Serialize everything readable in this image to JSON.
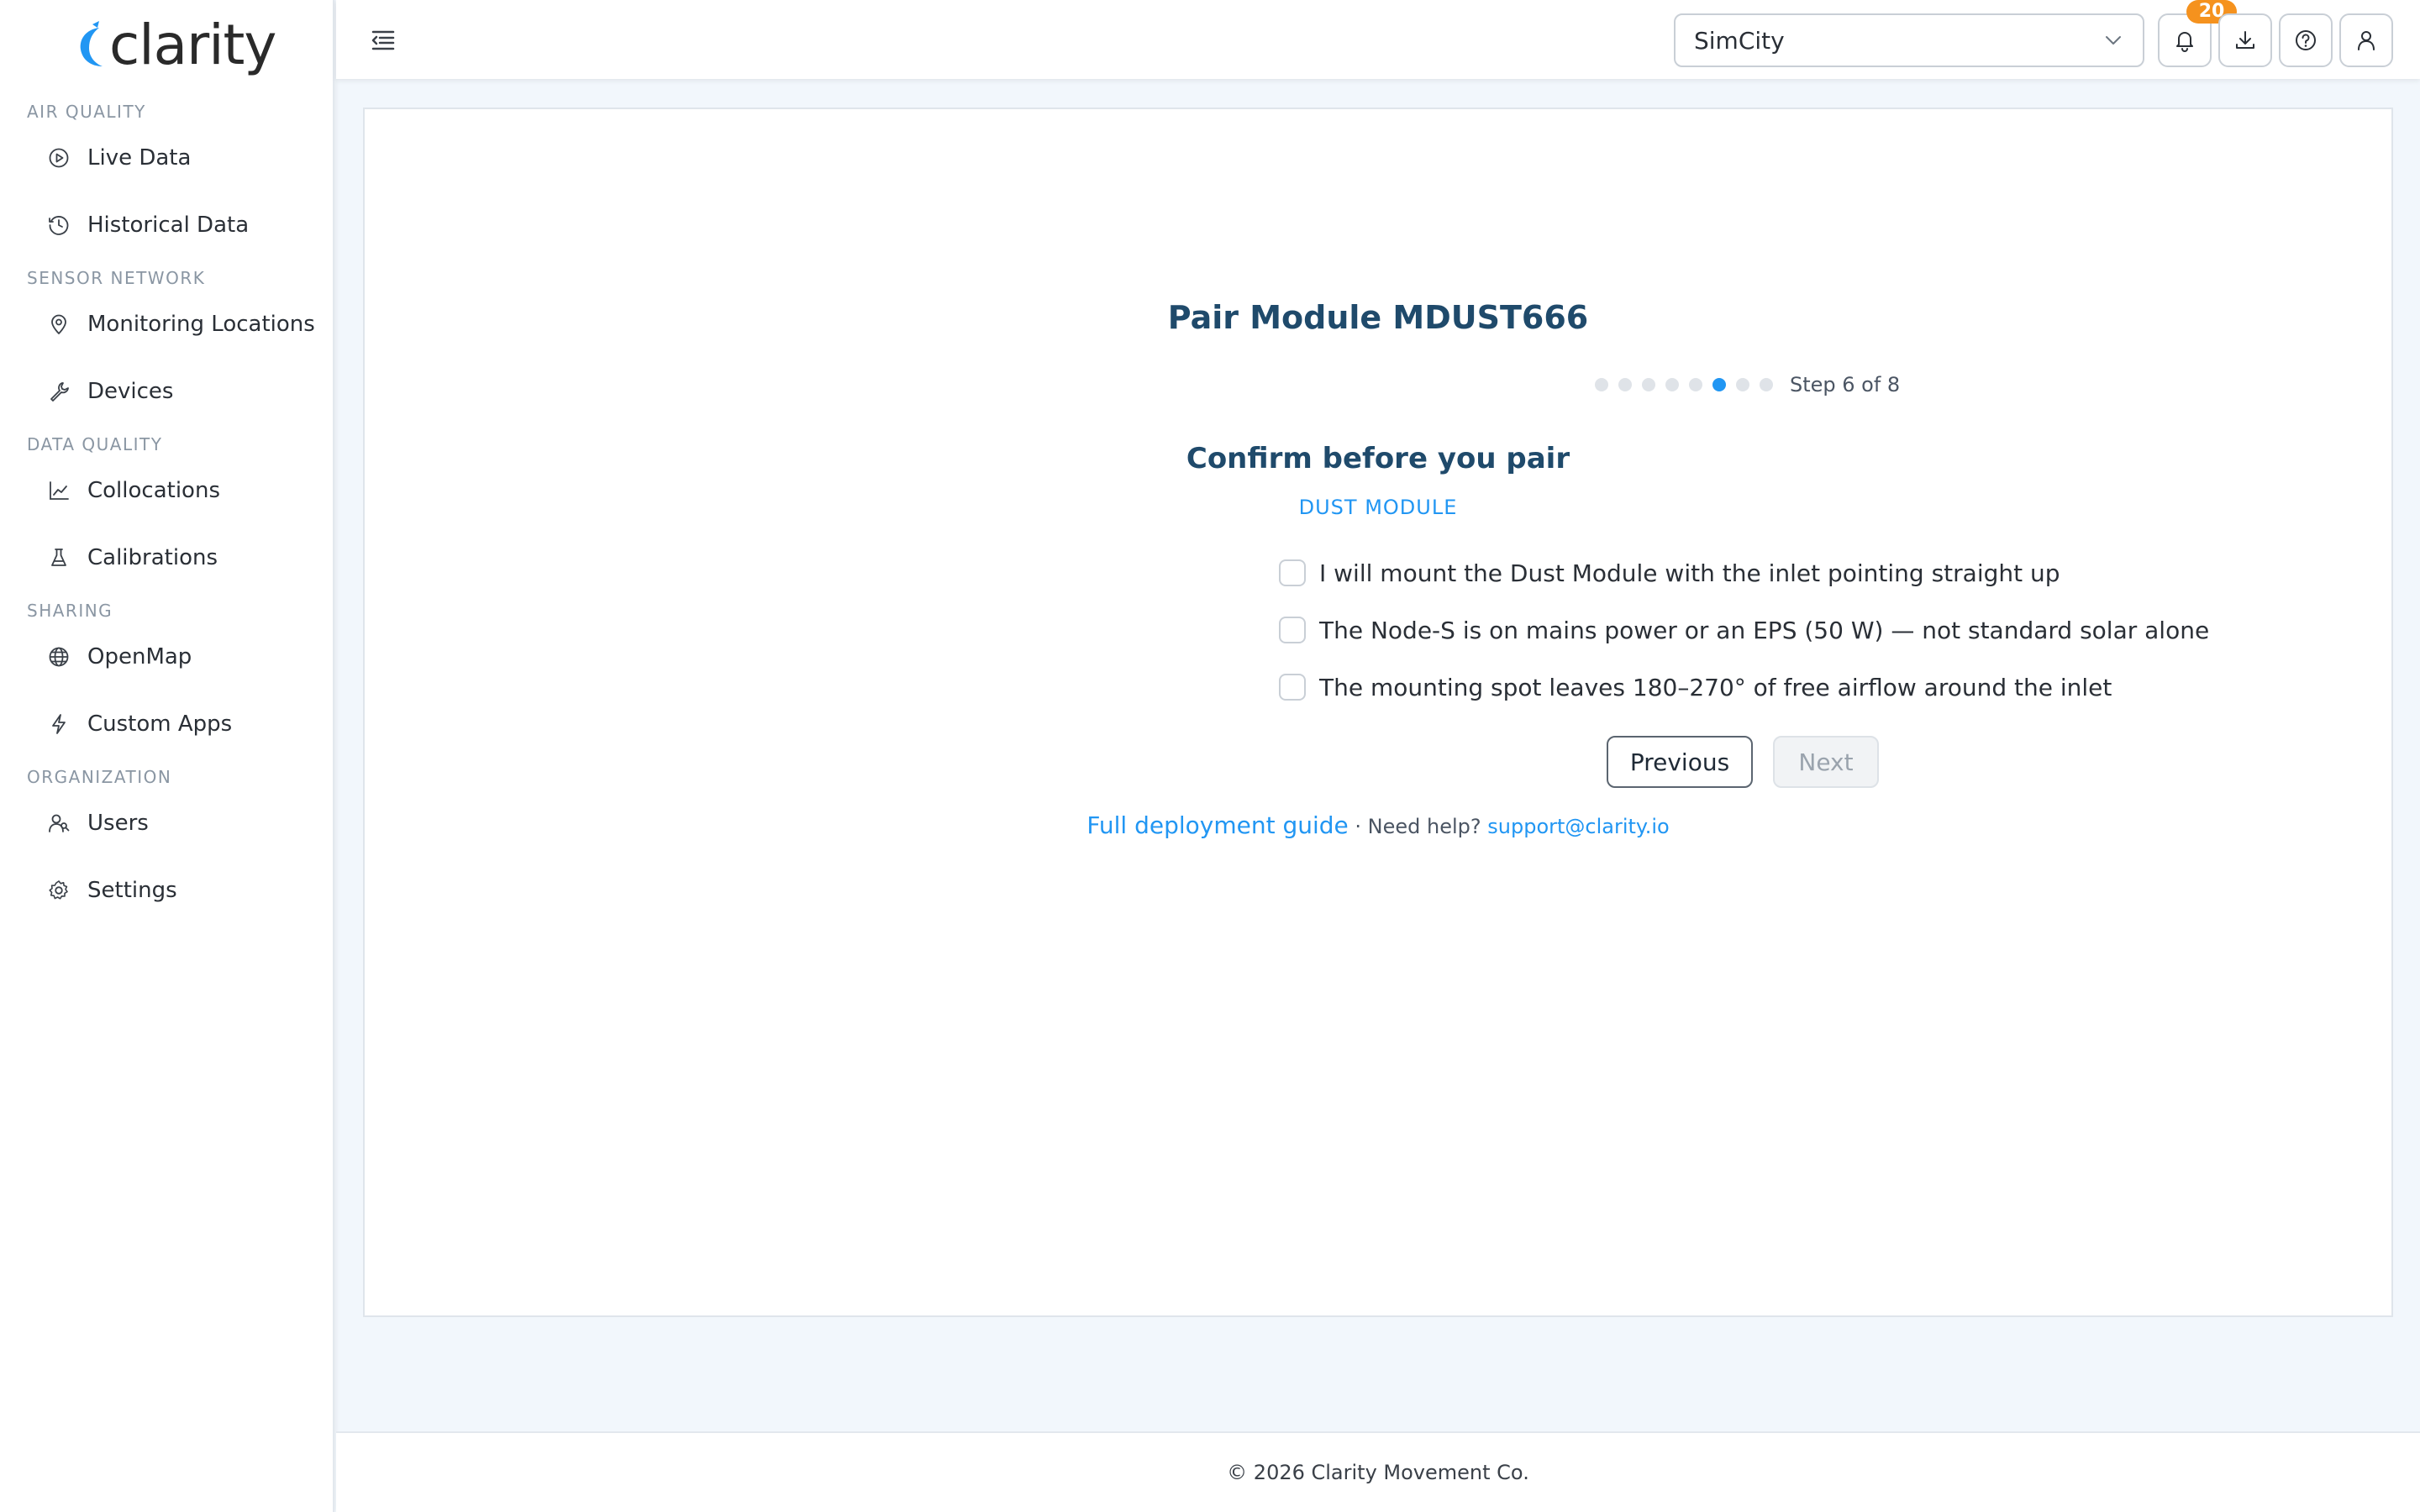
{
  "brand": {
    "name": "clarity",
    "accent": "#2196f3"
  },
  "sidebar": {
    "sections": [
      {
        "title": "AIR QUALITY",
        "items": [
          {
            "label": "Live Data",
            "icon": "play-circle-icon"
          },
          {
            "label": "Historical Data",
            "icon": "clock-icon"
          }
        ]
      },
      {
        "title": "SENSOR NETWORK",
        "items": [
          {
            "label": "Monitoring Locations",
            "icon": "location-pin-icon"
          },
          {
            "label": "Devices",
            "icon": "wrench-icon"
          }
        ]
      },
      {
        "title": "DATA QUALITY",
        "items": [
          {
            "label": "Collocations",
            "icon": "line-chart-icon"
          },
          {
            "label": "Calibrations",
            "icon": "flask-icon"
          }
        ]
      },
      {
        "title": "SHARING",
        "items": [
          {
            "label": "OpenMap",
            "icon": "globe-icon"
          },
          {
            "label": "Custom Apps",
            "icon": "lightning-icon"
          }
        ]
      },
      {
        "title": "ORGANIZATION",
        "items": [
          {
            "label": "Users",
            "icon": "users-icon"
          },
          {
            "label": "Settings",
            "icon": "gear-icon"
          }
        ]
      }
    ]
  },
  "topbar": {
    "org_selected": "SimCity",
    "notification_count": "20"
  },
  "wizard": {
    "title": "Pair Module MDUST666",
    "step_current": 6,
    "step_total": 8,
    "step_text": "Step 6 of 8",
    "subtitle": "Confirm before you pair",
    "module_label": "DUST MODULE",
    "checklist": [
      "I will mount the Dust Module with the inlet pointing straight up",
      "The Node-S is on mains power or an EPS (50 W) — not standard solar alone",
      "The mounting spot leaves 180–270° of free airflow around the inlet"
    ],
    "previous_label": "Previous",
    "next_label": "Next",
    "guide_link": "Full deployment guide",
    "separator": " · Need help? ",
    "support_email": "support@clarity.io"
  },
  "footer": {
    "text": "© 2026 Clarity Movement Co."
  }
}
